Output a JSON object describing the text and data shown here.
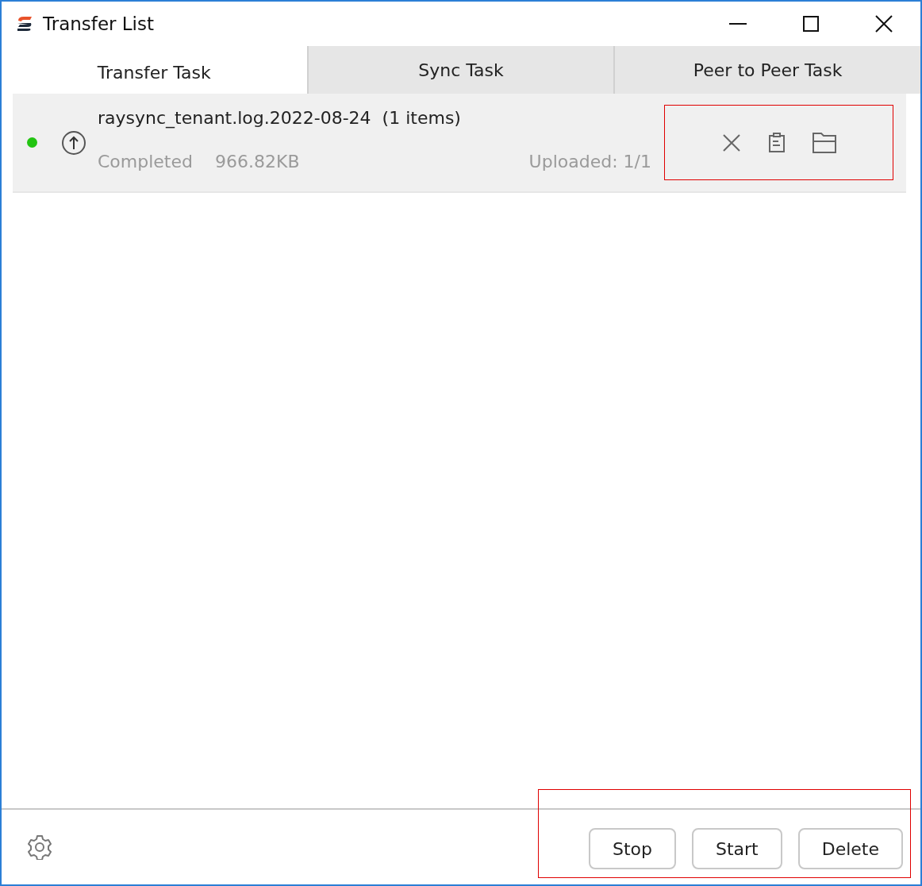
{
  "window": {
    "title": "Transfer List"
  },
  "tabs": [
    {
      "label": "Transfer Task",
      "selected": true
    },
    {
      "label": "Sync Task",
      "selected": false
    },
    {
      "label": "Peer to Peer Task",
      "selected": false
    }
  ],
  "tasks": [
    {
      "name": "raysync_tenant.log.2022-08-24",
      "count": "(1 items)",
      "status": "Completed",
      "size": "966.82KB",
      "progress": "Uploaded: 1/1",
      "color": "#22c411",
      "actions_highlighted": true
    }
  ],
  "footer": {
    "buttons": [
      "Stop",
      "Start",
      "Delete"
    ],
    "highlighted": true
  }
}
